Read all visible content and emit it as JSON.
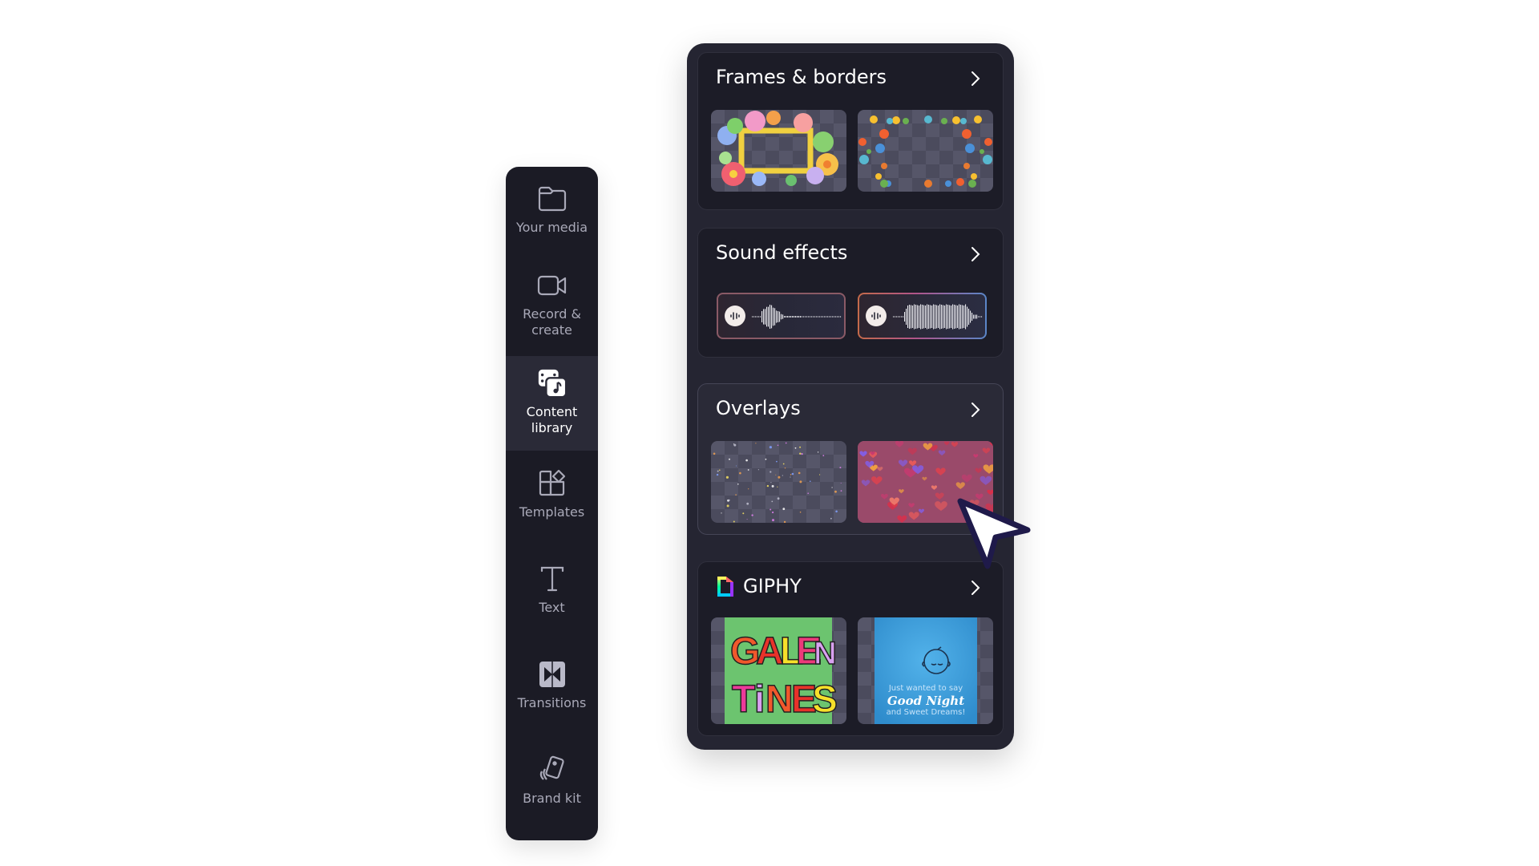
{
  "sidebar": {
    "items": [
      {
        "label": "Your media",
        "icon": "folder-icon",
        "active": false
      },
      {
        "label": "Record &\ncreate",
        "icon": "video-camera-icon",
        "active": false
      },
      {
        "label": "Content\nlibrary",
        "icon": "content-library-icon",
        "active": true
      },
      {
        "label": "Templates",
        "icon": "templates-icon",
        "active": false
      },
      {
        "label": "Text",
        "icon": "text-icon",
        "active": false
      },
      {
        "label": "Transitions",
        "icon": "transitions-icon",
        "active": false
      },
      {
        "label": "Brand kit",
        "icon": "brand-kit-icon",
        "active": false
      }
    ]
  },
  "panel": {
    "sections": [
      {
        "title": "Frames & borders",
        "items": [
          "flower-frame-thumbnail",
          "floral-border-thumbnail"
        ]
      },
      {
        "title": "Sound effects",
        "items": [
          "sound-effect-1",
          "sound-effect-2"
        ]
      },
      {
        "title": "Overlays",
        "items": [
          "sparkle-overlay-thumbnail",
          "hearts-overlay-thumbnail"
        ],
        "hovered": true
      },
      {
        "title": "GIPHY",
        "items": [
          "galentines-gif",
          "good-night-gif"
        ]
      }
    ],
    "giphy": {
      "galentines": {
        "line1": "GALEN",
        "line2": "TiNES"
      },
      "good_night": {
        "line1": "Just wanted to say",
        "line2": "Good Night",
        "line3": "and Sweet Dreams!"
      }
    }
  },
  "colors": {
    "sidebar_bg": "#1b1b25",
    "sidebar_active_bg": "#2a2a37",
    "panel_bg": "#252532",
    "card_bg": "#1c1c27",
    "cursor_outline": "#1f1a4a",
    "giphy_green": "#6cc46f",
    "giphy_blue": "#3fa0de"
  }
}
